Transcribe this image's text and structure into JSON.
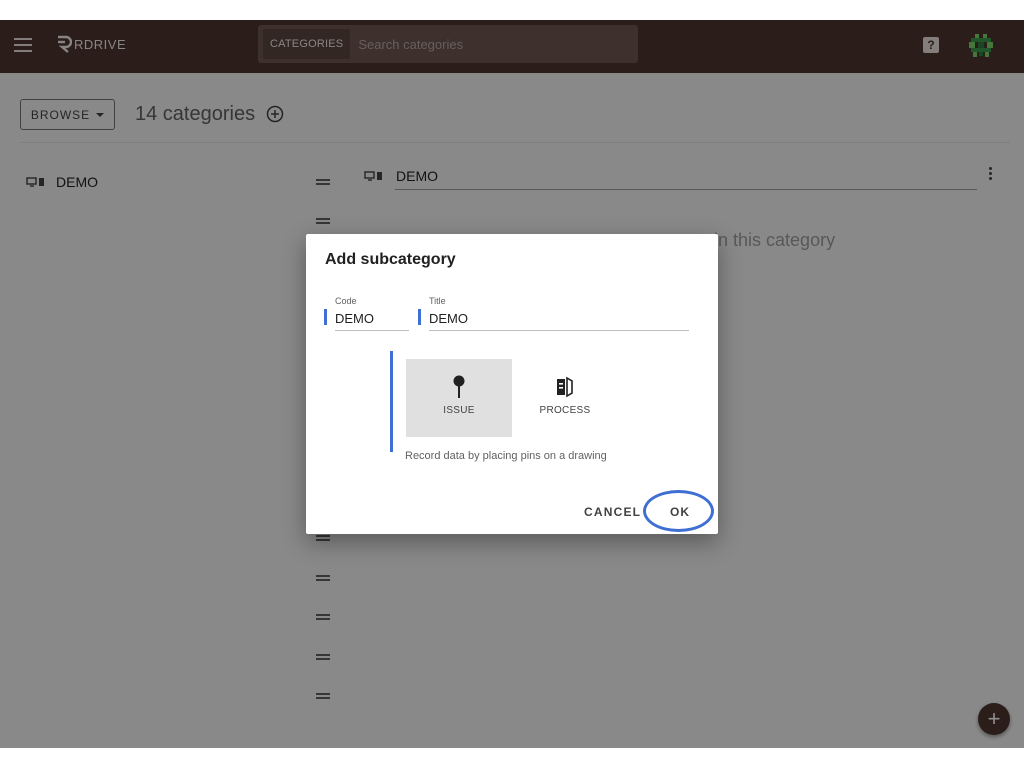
{
  "topbar": {
    "logo_text": "RDRIVE",
    "search_category": "CATEGORIES",
    "search_placeholder": "Search categories",
    "help_glyph": "?"
  },
  "toolbar": {
    "browse_label": "BROWSE",
    "category_count": "14 categories"
  },
  "left_list": [
    {
      "label": "DEMO",
      "icon": "device-icon"
    }
  ],
  "right_panel": {
    "title": "DEMO",
    "empty_message": "es in this category"
  },
  "dialog": {
    "title": "Add subcategory",
    "code_label": "Code",
    "code_value": "DEMO",
    "title_label": "Title",
    "title_value": "DEMO",
    "types": [
      {
        "label": "ISSUE",
        "icon": "pin-icon",
        "selected": true
      },
      {
        "label": "PROCESS",
        "icon": "process-icon",
        "selected": false
      }
    ],
    "type_description": "Record data by placing pins on a drawing",
    "cancel_label": "CANCEL",
    "ok_label": "OK"
  },
  "fab_glyph": "+",
  "colors": {
    "topbar": "#4e342e",
    "accent": "#3f6fd2",
    "overlay": "rgba(0,0,0,0.44)"
  }
}
